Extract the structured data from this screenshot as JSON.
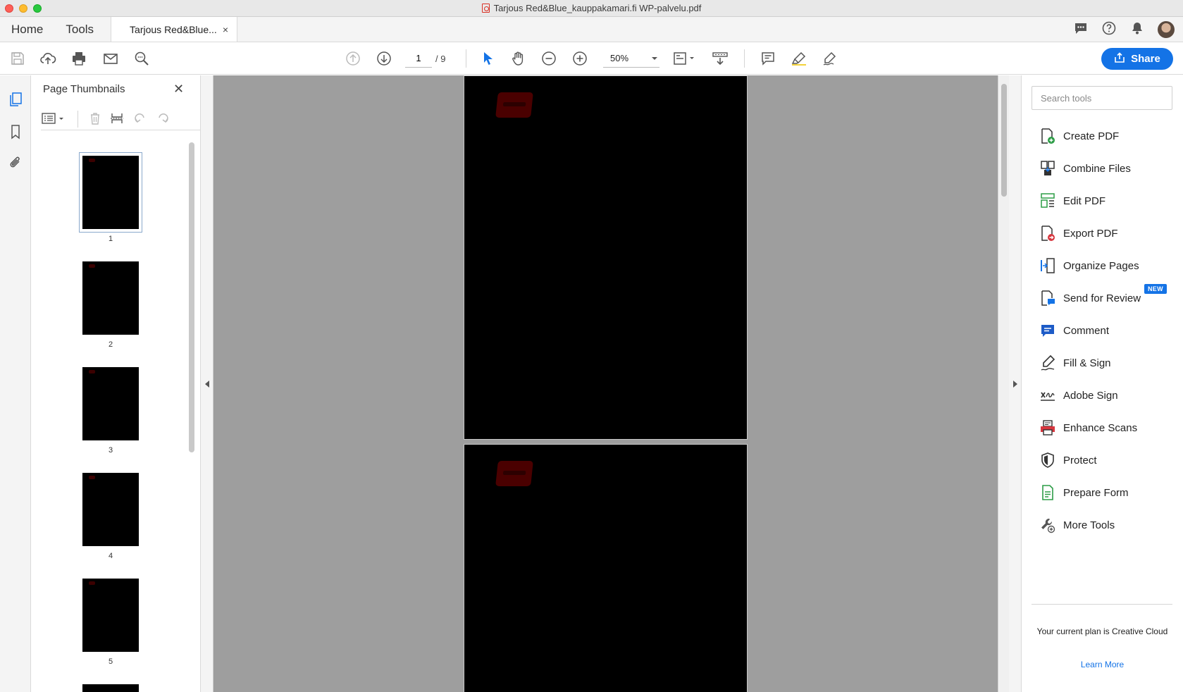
{
  "window": {
    "title": "Tarjous Red&Blue_kauppakamari.fi WP-palvelu.pdf"
  },
  "tabs": {
    "home": "Home",
    "tools": "Tools",
    "document": "Tarjous Red&Blue...",
    "close": "×"
  },
  "toolbar": {
    "page_current": "1",
    "page_total": "/ 9",
    "zoom": "50%",
    "share": "Share"
  },
  "thumbnails": {
    "title": "Page Thumbnails",
    "close": "✕",
    "pages": [
      "1",
      "2",
      "3",
      "4",
      "5"
    ]
  },
  "tools_panel": {
    "search_placeholder": "Search tools",
    "items": [
      "Create PDF",
      "Combine Files",
      "Edit PDF",
      "Export PDF",
      "Organize Pages",
      "Send for Review",
      "Comment",
      "Fill & Sign",
      "Adobe Sign",
      "Enhance Scans",
      "Protect",
      "Prepare Form",
      "More Tools"
    ],
    "new_badge": "NEW",
    "plan_text": "Your current plan is Creative Cloud",
    "learn_more": "Learn More"
  },
  "colors": {
    "accent": "#1473e6",
    "document_bg": "#9e9e9e",
    "page_fill": "#000000"
  }
}
